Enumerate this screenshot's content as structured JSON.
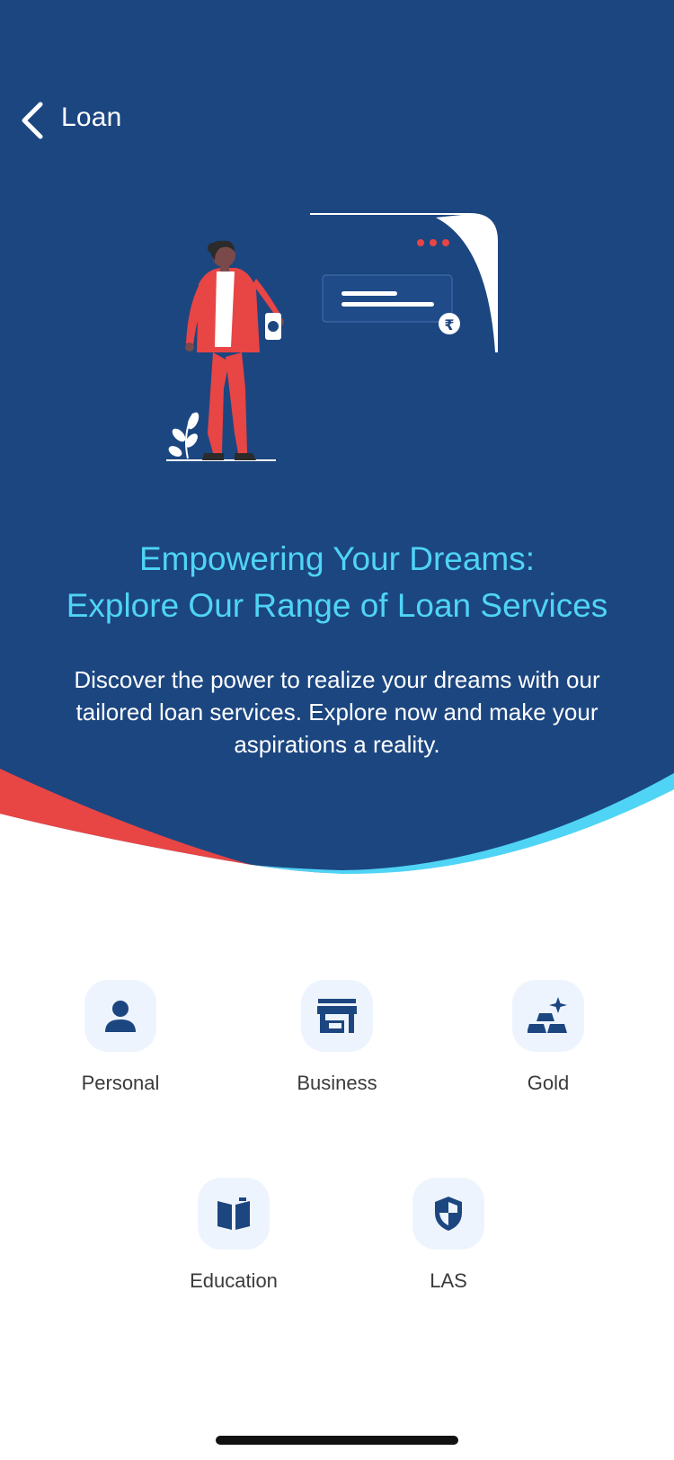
{
  "header": {
    "back_icon": "chevron-left-icon",
    "title": "Loan"
  },
  "hero": {
    "headline_line1": "Empowering Your Dreams:",
    "headline_line2": "Explore Our Range of Loan Services",
    "description": "Discover the power to realize your dreams with our tailored loan services. Explore now and make your aspirations a reality.",
    "currency_symbol": "₹"
  },
  "services": [
    {
      "label": "Personal",
      "icon": "person-icon"
    },
    {
      "label": "Business",
      "icon": "storefront-icon"
    },
    {
      "label": "Gold",
      "icon": "gold-bars-icon"
    },
    {
      "label": "Education",
      "icon": "book-icon"
    },
    {
      "label": "LAS",
      "icon": "shield-icon"
    }
  ],
  "colors": {
    "hero_background": "#1c4680",
    "headline": "#4fd4f6",
    "accent_red": "#e84545",
    "accent_cyan": "#4fd4f6",
    "icon": "#1c4680",
    "icon_background": "#eef4fd"
  }
}
